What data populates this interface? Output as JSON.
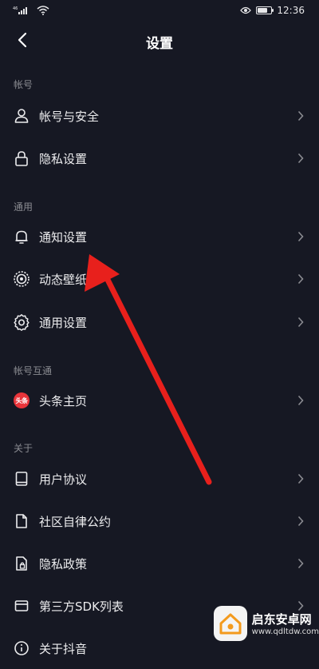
{
  "status_bar": {
    "signal": "⁴⁶ .ıll",
    "time": "12:36",
    "battery_level": 0.8
  },
  "header": {
    "title": "设置",
    "back_icon": "chevron-left-icon"
  },
  "sections": [
    {
      "title": "帐号"
    },
    {
      "title": "通用"
    },
    {
      "title": "帐号互通"
    },
    {
      "title": "关于"
    }
  ],
  "items": [
    {
      "label": "帐号与安全",
      "icon": "user-icon"
    },
    {
      "label": "隐私设置",
      "icon": "lock-icon"
    },
    {
      "label": "通知设置",
      "icon": "bell-icon"
    },
    {
      "label": "动态壁纸",
      "icon": "wallpaper-icon"
    },
    {
      "label": "通用设置",
      "icon": "gear-icon"
    },
    {
      "label": "头条主页",
      "icon": "toutiao-icon",
      "badge": "头条"
    },
    {
      "label": "用户协议",
      "icon": "book-icon"
    },
    {
      "label": "社区自律公约",
      "icon": "document-icon"
    },
    {
      "label": "隐私政策",
      "icon": "privacy-doc-icon"
    },
    {
      "label": "第三方SDK列表",
      "icon": "card-icon"
    },
    {
      "label": "关于抖音",
      "icon": "info-icon"
    }
  ],
  "annotation": {
    "color": "#e8201c"
  },
  "watermark": {
    "name": "启东安卓网",
    "url": "www.qdltdw.com",
    "accent": "#f39a1d"
  },
  "colors": {
    "background": "#161823",
    "text": "#ececee",
    "muted": "#8a8b91"
  }
}
